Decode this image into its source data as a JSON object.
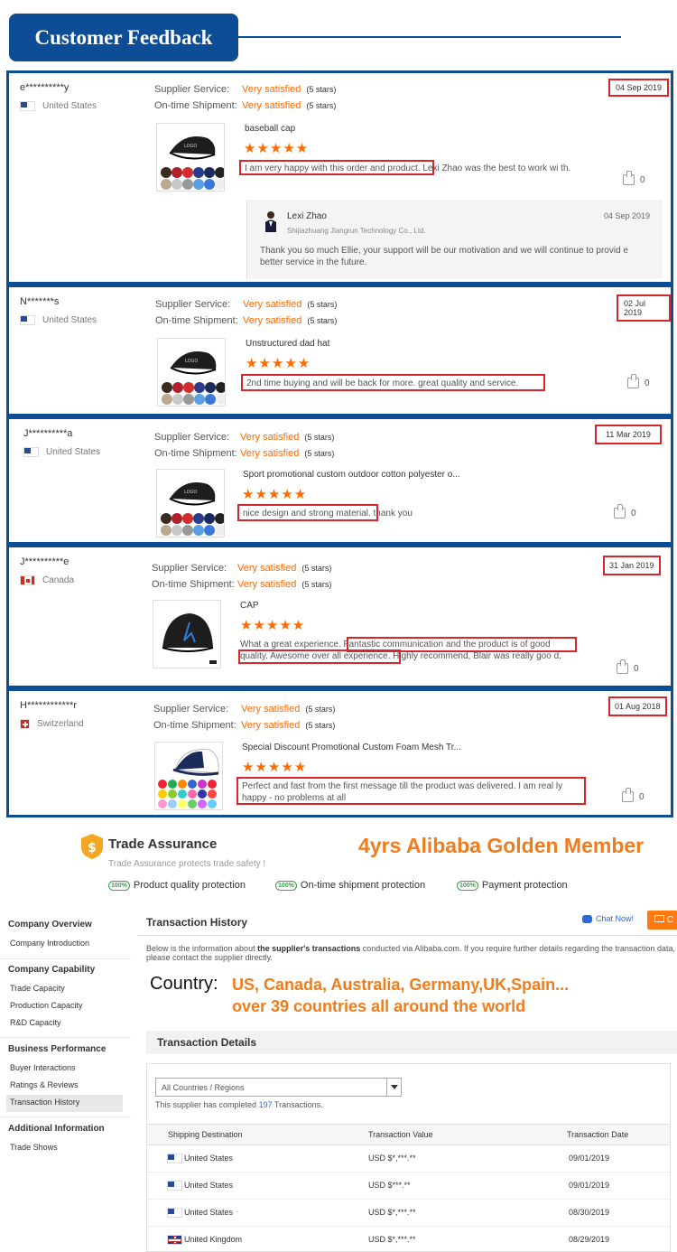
{
  "header": {
    "title": "Customer Feedback"
  },
  "reviews": [
    {
      "buyer": "e**********y",
      "country": "United States",
      "supplier_service_label": "Supplier Service:",
      "supplier_service_value": "Very satisfied",
      "supplier_service_stars": "(5 stars)",
      "shipment_label": "On-time Shipment:",
      "shipment_value": "Very satisfied",
      "shipment_stars": "(5 stars)",
      "date": "04 Sep 2019",
      "product": "baseball cap",
      "rating": "★★★★★",
      "comment": "I am very happy with this order and product. Lexi Zhao was the best to work wi th.",
      "likes": "0",
      "reply": {
        "name": "Lexi Zhao",
        "company": "Shijiazhuang Jiangrun Technology Co., Ltd.",
        "date": "04 Sep 2019",
        "text": "Thank you so much Ellie, your support will be our motivation and we will continue to provid e better service in the future."
      }
    },
    {
      "buyer": "N*******s",
      "country": "United States",
      "supplier_service_label": "Supplier Service:",
      "supplier_service_value": "Very satisfied",
      "supplier_service_stars": "(5 stars)",
      "shipment_label": "On-time Shipment:",
      "shipment_value": "Very satisfied",
      "shipment_stars": "(5 stars)",
      "date": "02 Jul 2019",
      "product": "Unstructured dad hat",
      "rating": "★★★★★",
      "comment": "2nd time buying and will be back for more. great quality and service.",
      "likes": "0"
    },
    {
      "buyer": "J**********a",
      "country": "United States",
      "supplier_service_label": "Supplier Service:",
      "supplier_service_value": "Very satisfied",
      "supplier_service_stars": "(5 stars)",
      "shipment_label": "On-time Shipment:",
      "shipment_value": "Very satisfied",
      "shipment_stars": "(5 stars)",
      "date": "11 Mar 2019",
      "product": "Sport promotional custom outdoor cotton polyester o...",
      "rating": "★★★★★",
      "comment": "nice design and strong material. thank you",
      "likes": "0"
    },
    {
      "buyer": "J**********e",
      "country": "Canada",
      "supplier_service_label": "Supplier Service:",
      "supplier_service_value": "Very satisfied",
      "supplier_service_stars": "(5 stars)",
      "shipment_label": "On-time Shipment:",
      "shipment_value": "Very satisfied",
      "shipment_stars": "(5 stars)",
      "date": "31 Jan 2019",
      "product": "CAP",
      "rating": "★★★★★",
      "comment": "What a great experience. Fantastic communication and the product is of good quality. Awesome over all experience. Highly recommend, Blair was really goo d.",
      "likes": "0"
    },
    {
      "buyer": "H************r",
      "country": "Switzerland",
      "supplier_service_label": "Supplier Service:",
      "supplier_service_value": "Very satisfied",
      "supplier_service_stars": "(5 stars)",
      "shipment_label": "On-time Shipment:",
      "shipment_value": "Very satisfied",
      "shipment_stars": "(5 stars)",
      "date": "01 Aug 2018",
      "product": "Special Discount Promotional Custom Foam Mesh Tr...",
      "rating": "★★★★★",
      "comment": "Perfect and fast from the first message till the product was delivered. I am real ly happy - no problems at all",
      "likes": "0"
    }
  ],
  "trade_assurance": {
    "title": "Trade Assurance",
    "subtitle": "Trade Assurance protects trade safety !",
    "golden_member": "4yrs Alibaba Golden Member",
    "badge": "100%",
    "protections": [
      "Product quality protection",
      "On-time shipment protection",
      "Payment protection"
    ]
  },
  "sidebar": {
    "sections": [
      {
        "title": "Company Overview",
        "items": [
          "Company Introduction"
        ]
      },
      {
        "title": "Company Capability",
        "items": [
          "Trade Capacity",
          "Production Capacity",
          "R&D Capacity"
        ]
      },
      {
        "title": "Business Performance",
        "items": [
          "Buyer Interactions",
          "Ratings & Reviews",
          "Transaction History"
        ]
      },
      {
        "title": "Additional Information",
        "items": [
          "Trade Shows"
        ]
      }
    ]
  },
  "main": {
    "title": "Transaction History",
    "chat_now": "Chat Now!",
    "contact_label": "C",
    "intro_pre": "Below is the information about ",
    "intro_bold": "the supplier's transactions",
    "intro_post": " conducted via Alibaba.com. If you require further details regarding the transaction data, please contact the supplier directly.",
    "country_label": "Country:",
    "country_line1": "US, Canada, Australia, Germany,UK,Spain...",
    "country_line2": "over 39 countries all around the world",
    "details_title": "Transaction Details",
    "select_value": "All Countries / Regions",
    "completed_pre": "This supplier has completed ",
    "completed_num": "197",
    "completed_post": " Transactions.",
    "table": {
      "headers": [
        "Shipping Destination",
        "Transaction Value",
        "Transaction Date"
      ],
      "rows": [
        {
          "flag": "us",
          "dest": "United States",
          "value": "USD $*,***.**",
          "date": "09/01/2019"
        },
        {
          "flag": "us",
          "dest": "United States",
          "value": "USD $***.**",
          "date": "09/01/2019"
        },
        {
          "flag": "us",
          "dest": "United States",
          "value": "USD $*,***.**",
          "date": "08/30/2019"
        },
        {
          "flag": "uk",
          "dest": "United Kingdom",
          "value": "USD $*,***.**",
          "date": "08/29/2019"
        }
      ]
    }
  }
}
